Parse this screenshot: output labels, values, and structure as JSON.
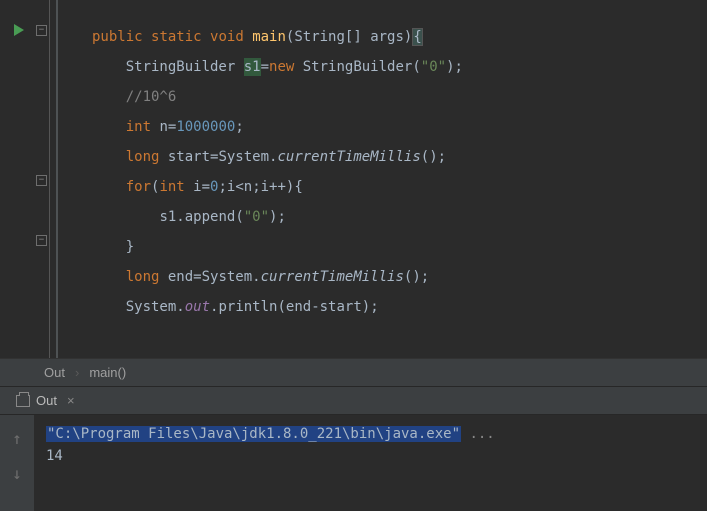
{
  "code": {
    "kw_public": "public",
    "kw_static": "static",
    "kw_void": "void",
    "main": "main",
    "params": "(String[] args)",
    "lbrace": "{",
    "sb_type": "StringBuilder ",
    "s1_decl": "s1",
    "eq": "=",
    "kw_new": "new",
    "sb_ctor": " StringBuilder(",
    "str_zero": "\"0\"",
    "rparen_semi": ");",
    "comment": "//10^6",
    "kw_int": "int",
    "n_decl": " n",
    "num_mill": "1000000",
    "semi": ";",
    "kw_long": "long",
    "start_decl": " start",
    "system": "System.",
    "ctm": "currentTimeMillis",
    "empty_call": "();",
    "kw_for": "for",
    "lparen": "(",
    "i_decl": " i",
    "num_zero": "0",
    "cond": ";i<n;i++){",
    "s1_var": "s1.",
    "append": "append",
    "append_arg": "(",
    "append_end": ");",
    "rbrace": "}",
    "end_decl": " end",
    "out": "out",
    "dot": ".",
    "println": "println",
    "println_arg": "(end-start);"
  },
  "breadcrumb": {
    "class": "Out",
    "sep": "›",
    "method": "main()"
  },
  "toolwindow": {
    "tab_label": "Out",
    "close": "×"
  },
  "console": {
    "path_prefix": "\"C:\\Program Files\\Java\\jdk1.8.0_221\\bin\\java.exe\"",
    "path_suffix": " ...",
    "result": "14"
  }
}
